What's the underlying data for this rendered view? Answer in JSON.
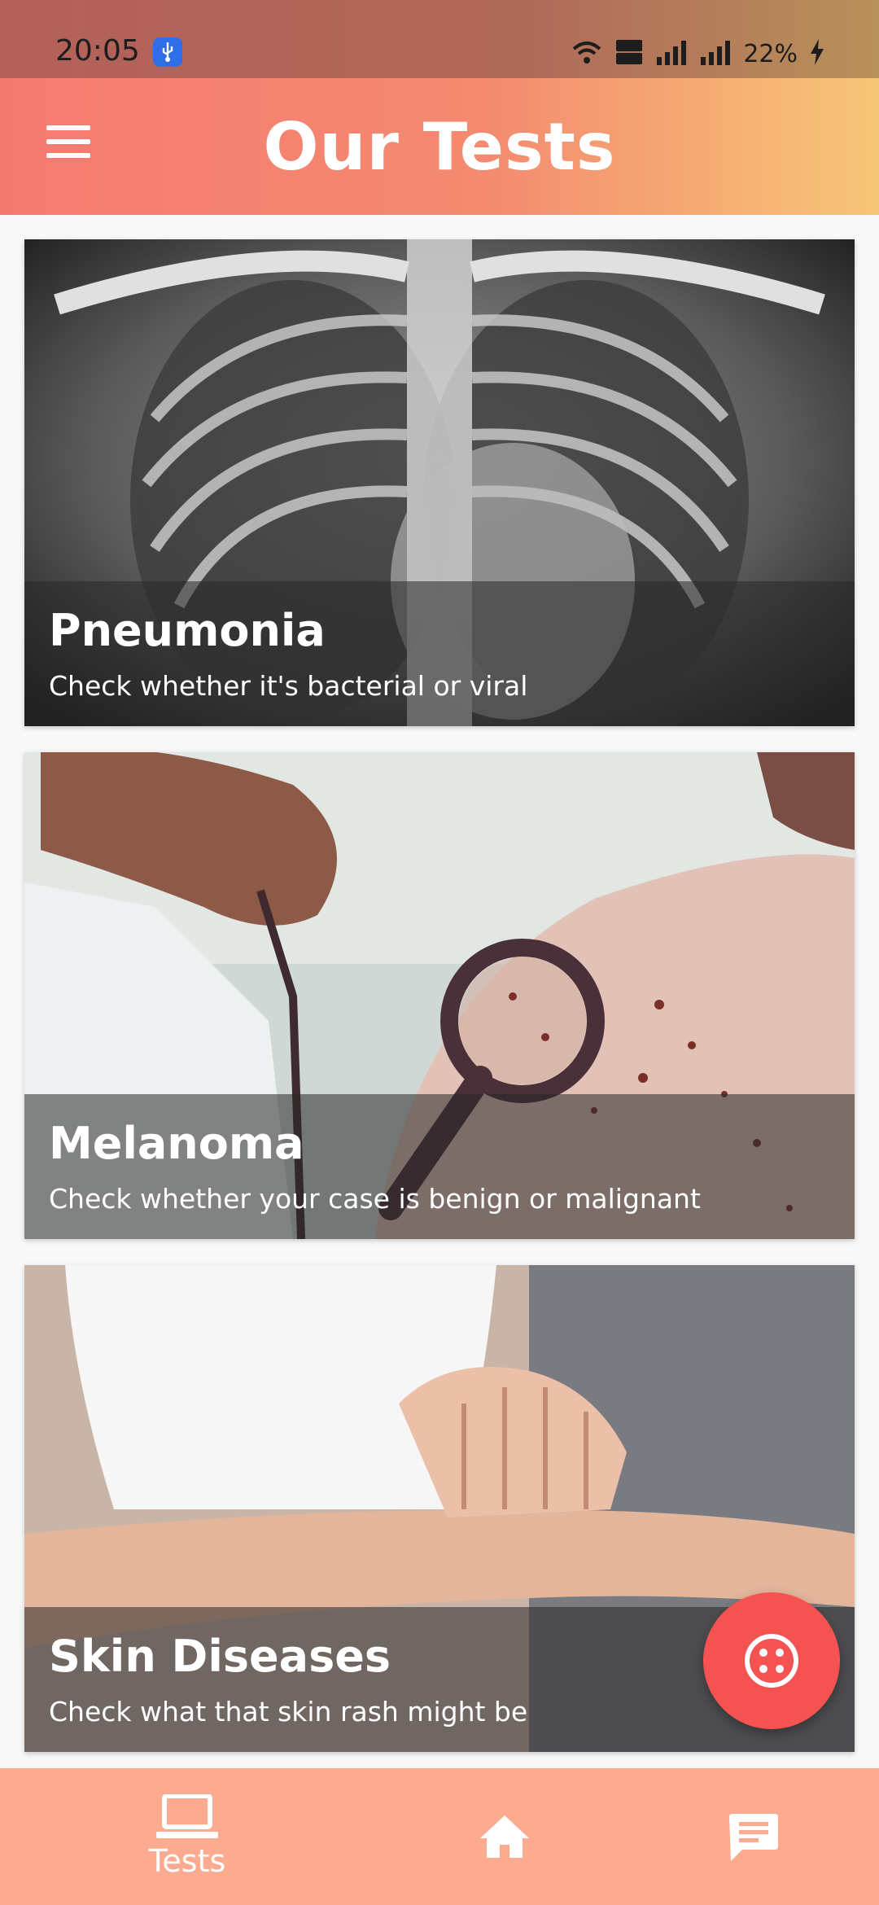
{
  "status_bar": {
    "time": "20:05",
    "battery": "22%",
    "icons": [
      "usb-icon",
      "wifi-icon",
      "volte-icon",
      "signal-icon",
      "signal-icon",
      "battery-charging-icon"
    ]
  },
  "app_bar": {
    "title": "Our Tests",
    "menu_icon": "hamburger-menu-icon"
  },
  "tests": [
    {
      "title": "Pneumonia",
      "subtitle": "Check whether it's bacterial or viral",
      "image": "chest-xray"
    },
    {
      "title": "Melanoma",
      "subtitle": "Check whether your case is benign or malignant",
      "image": "doctor-magnifier-skin"
    },
    {
      "title": "Skin Diseases",
      "subtitle": "Check what that skin rash might be",
      "image": "arm-scratching"
    }
  ],
  "fab": {
    "icon": "petri-dish-icon",
    "color": "#f55252"
  },
  "bottom_nav": {
    "items": [
      {
        "label": "Tests",
        "icon": "laptop-icon",
        "active": true
      },
      {
        "label": "",
        "icon": "home-icon",
        "active": false
      },
      {
        "label": "",
        "icon": "chat-icon",
        "active": false
      }
    ]
  },
  "colors": {
    "accent": "#f47a70",
    "nav_background": "#fdab90"
  }
}
